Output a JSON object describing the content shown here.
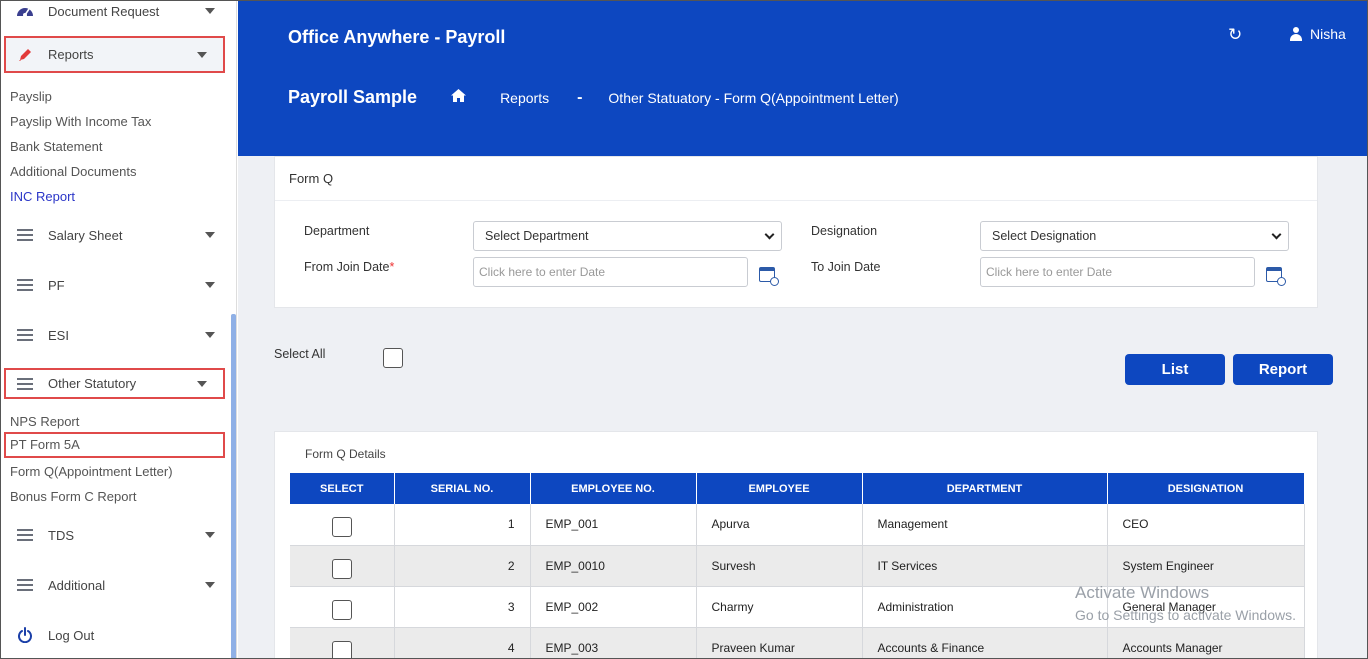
{
  "sidebar": {
    "document_request": "Document Request",
    "reports": "Reports",
    "reports_items": [
      "Payslip",
      "Payslip With Income Tax",
      "Bank Statement",
      "Additional Documents",
      "INC Report"
    ],
    "salary_sheet": "Salary Sheet",
    "pf": "PF",
    "esi": "ESI",
    "other_statutory": "Other Statutory",
    "other_items": [
      "NPS Report",
      "PT Form 5A",
      "Form Q(Appointment Letter)",
      "Bonus Form C Report"
    ],
    "tds": "TDS",
    "additional": "Additional",
    "logout": "Log Out"
  },
  "header": {
    "app_title": "Office Anywhere - Payroll",
    "user": "Nisha",
    "org": "Payroll Sample",
    "crumb_reports": "Reports",
    "crumb_sep": "-",
    "crumb_page": "Other Statuatory - Form Q(Appointment Letter)"
  },
  "form": {
    "title": "Form Q",
    "department_label": "Department",
    "department_value": "Select Department",
    "designation_label": "Designation",
    "designation_value": "Select Designation",
    "from_label": "From Join Date",
    "from_required": "*",
    "from_placeholder": "Click here to enter Date",
    "to_label": "To Join Date",
    "to_placeholder": "Click here to enter Date"
  },
  "actions": {
    "select_all": "Select All",
    "list": "List",
    "report": "Report"
  },
  "table": {
    "title": "Form Q Details",
    "headers": [
      "SELECT",
      "SERIAL NO.",
      "EMPLOYEE NO.",
      "EMPLOYEE",
      "DEPARTMENT",
      "DESIGNATION"
    ],
    "rows": [
      {
        "serial": "1",
        "emp_no": "EMP_001",
        "name": "Apurva",
        "dept": "Management",
        "desig": "CEO"
      },
      {
        "serial": "2",
        "emp_no": "EMP_0010",
        "name": "Survesh",
        "dept": "IT Services",
        "desig": "System Engineer"
      },
      {
        "serial": "3",
        "emp_no": "EMP_002",
        "name": "Charmy",
        "dept": "Administration",
        "desig": "General Manager"
      },
      {
        "serial": "4",
        "emp_no": "EMP_003",
        "name": "Praveen Kumar",
        "dept": "Accounts & Finance",
        "desig": "Accounts Manager"
      }
    ]
  },
  "watermark": {
    "line1": "Activate Windows",
    "line2": "Go to Settings to activate Windows."
  },
  "colors": {
    "brand": "#0d47c0",
    "highlight": "#e04a4a",
    "active_link": "#2b36c8"
  }
}
